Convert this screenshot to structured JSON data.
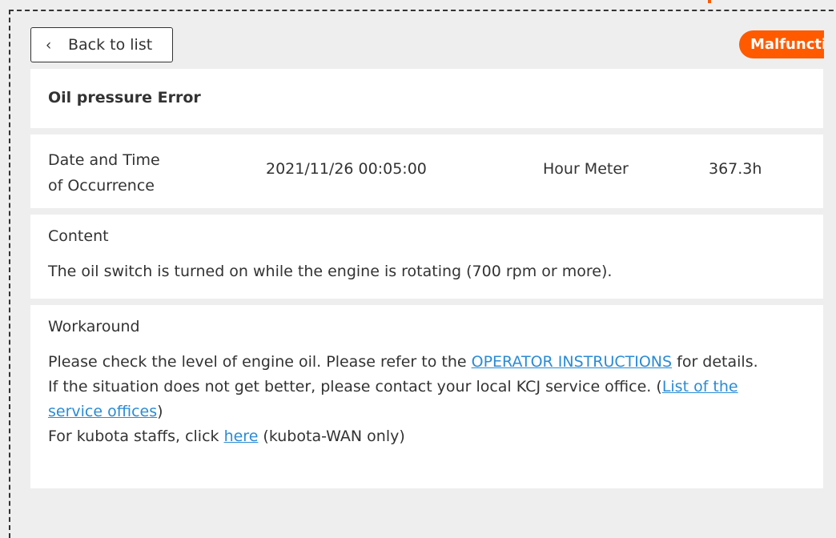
{
  "toolbar": {
    "back_label": "Back to list",
    "back_icon": "chevron-left-icon"
  },
  "status": {
    "label": "Malfunction",
    "color": "#ff5a00"
  },
  "error": {
    "title": "Oil pressure Error"
  },
  "occurrence": {
    "label_line1": "Date and Time",
    "label_line2": "of Occurrence",
    "datetime": "2021/11/26 00:05:00",
    "hour_meter_label": "Hour Meter",
    "hour_meter_value": "367.3h"
  },
  "content": {
    "heading": "Content",
    "text": "The oil switch is turned on while the engine is rotating (700 rpm or more)."
  },
  "workaround": {
    "heading": "Workaround",
    "line1_before": "Please check the level of engine oil. Please refer to the ",
    "operator_link": "OPERATOR INSTRUCTIONS",
    "line1_after": " for details.",
    "line2_before": "If the situation does not get better, please contact your local KCJ service office. (",
    "offices_link": "List of the service offices",
    "line2_after": ")",
    "line3_before": "For kubota staffs, click ",
    "here_link": "here",
    "line3_after": " (kubota-WAN only)"
  },
  "colors": {
    "link": "#2a8bd6",
    "accent": "#ff5a00"
  }
}
